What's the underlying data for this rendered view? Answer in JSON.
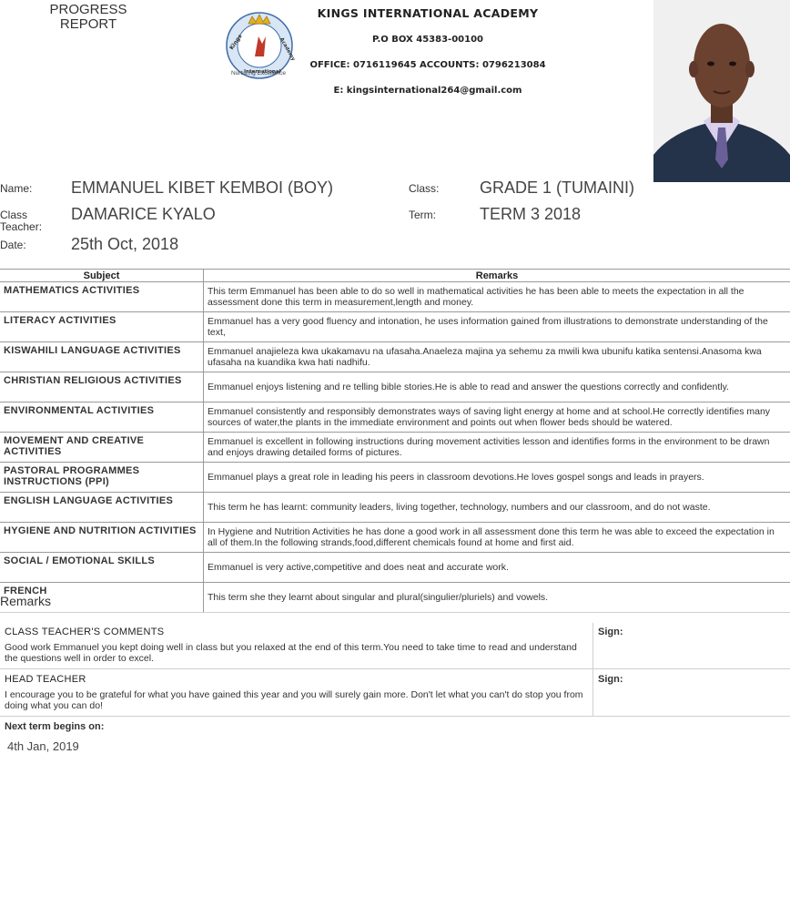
{
  "header": {
    "doc_title_line1": "PROGRESS",
    "doc_title_line2": "REPORT",
    "school_name": "KINGS INTERNATIONAL ACADEMY",
    "po_box": "P.O BOX 45383-00100",
    "phones": "OFFICE: 0716119645 ACCOUNTS: 0796213084",
    "email": "E: kingsinternational264@gmail.com",
    "logo_top_text": "Kings",
    "logo_right_text": "Academy",
    "logo_bottom_text": "International",
    "logo_caption": "Nurturing Excellence"
  },
  "student": {
    "name_label": "Name:",
    "name": "EMMANUEL KIBET KEMBOI (BOY)",
    "class_label": "Class:",
    "class": "GRADE 1 (TUMAINI)",
    "teacher_label_line1": "Class",
    "teacher_label_line2": "Teacher:",
    "teacher": "DAMARICE KYALO",
    "term_label": "Term:",
    "term": "TERM 3 2018",
    "date_label": "Date:",
    "date": "25th Oct, 2018"
  },
  "table": {
    "col_subject": "Subject",
    "col_remarks": "Remarks",
    "rows": [
      {
        "subject": "MATHEMATICS ACTIVITIES",
        "remark": "This term Emmanuel has been able to do so well in mathematical activities he has been able to meets the expectation in all the assessment done this term in measurement,length and money."
      },
      {
        "subject": "LITERACY ACTIVITIES",
        "remark": "Emmanuel has a very good fluency and intonation, he uses information gained from illustrations to demonstrate understanding of the text,"
      },
      {
        "subject": "KISWAHILI LANGUAGE ACTIVITIES",
        "remark": "Emmanuel anajieleza kwa ukakamavu na ufasaha.Anaeleza majina ya sehemu za mwili kwa ubunifu katika sentensi.Anasoma kwa ufasaha na kuandika kwa hati nadhifu."
      },
      {
        "subject": "CHRISTIAN RELIGIOUS ACTIVITIES",
        "remark": "Emmanuel enjoys listening and re telling bible stories.He is able to read and answer the questions correctly and confidently."
      },
      {
        "subject": "ENVIRONMENTAL ACTIVITIES",
        "remark": "Emmanuel consistently and responsibly demonstrates ways of saving light energy at home and at school.He correctly identifies many sources of water,the plants in the immediate environment and points out when flower beds should be watered."
      },
      {
        "subject": "MOVEMENT AND CREATIVE ACTIVITIES",
        "remark": "Emmanuel is excellent in following instructions during movement activities lesson and identifies forms in the environment to be drawn and enjoys drawing detailed forms of pictures."
      },
      {
        "subject": "PASTORAL PROGRAMMES INSTRUCTIONS (PPI)",
        "remark": "Emmanuel plays a great role in leading his peers in classroom devotions.He loves gospel songs and leads in prayers."
      },
      {
        "subject": "ENGLISH LANGUAGE ACTIVITIES",
        "remark": "This term he has learnt: community leaders, living together, technology, numbers and our classroom, and do not waste."
      },
      {
        "subject": "HYGIENE AND NUTRITION ACTIVITIES",
        "remark": "In Hygiene and Nutrition Activities he has done a good work in all assessment done this term he was able to exceed the expectation in all of them.In the following strands,food,different chemicals found at home and first aid."
      },
      {
        "subject": "SOCIAL / EMOTIONAL SKILLS",
        "remark": "Emmanuel is very active,competitive and does neat and accurate work."
      },
      {
        "subject": "FRENCH",
        "remark": "This term she they learnt about singular and plural(singulier/pluriels) and vowels."
      }
    ]
  },
  "remarks": {
    "heading": "Remarks",
    "class_teacher_title": "CLASS TEACHER'S COMMENTS",
    "class_teacher_comment": "Good work Emmanuel you kept doing well in class but you relaxed at the end of this term.You need to take time to read and understand the questions well in order to excel.",
    "head_teacher_title": "HEAD TEACHER",
    "head_teacher_comment": "I encourage you to be grateful for what you have gained this year and you will surely gain more. Don't let what you can't do stop you from doing what you can do!",
    "sign_label": "Sign:"
  },
  "next_term": {
    "label": "Next term begins on:",
    "date": "4th Jan, 2019"
  }
}
